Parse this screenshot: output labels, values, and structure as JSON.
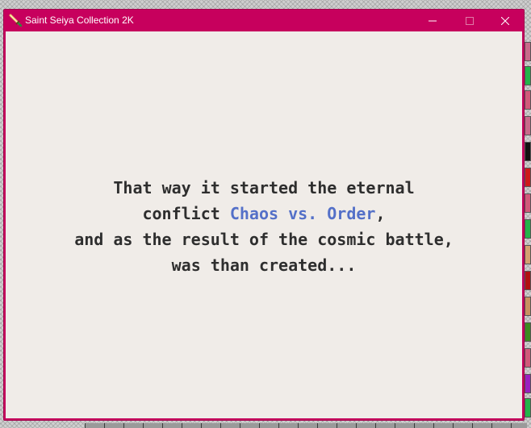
{
  "window": {
    "title": "Saint Seiya Collection 2K",
    "titlebar_color": "#c7005d",
    "client_bg": "#f0ece8"
  },
  "icons": {
    "app": "sword-icon",
    "minimize": "minimize-icon",
    "maximize": "maximize-icon",
    "close": "close-icon"
  },
  "story": {
    "line1": "That way it started the eternal",
    "line2_prefix": "conflict ",
    "line2_highlight": "Chaos vs. Order",
    "line2_suffix": ",",
    "line3": "and as the result of the cosmic battle,",
    "line4": "was than created...",
    "text_color": "#2e2e2e",
    "highlight_color": "#5470c8"
  },
  "desktop": {
    "swatch_colors": [
      "#c86a8a",
      "#24b34a",
      "#d05a7a",
      "#c86a8a",
      "#e07a9a",
      "#111111",
      "#cc1a1a",
      "#d05a7a",
      "#24b34a",
      "#d4a070",
      "#b01010",
      "#c89060",
      "#3c8a20",
      "#d05a7a",
      "#9a20c0",
      "#24b34a"
    ]
  }
}
